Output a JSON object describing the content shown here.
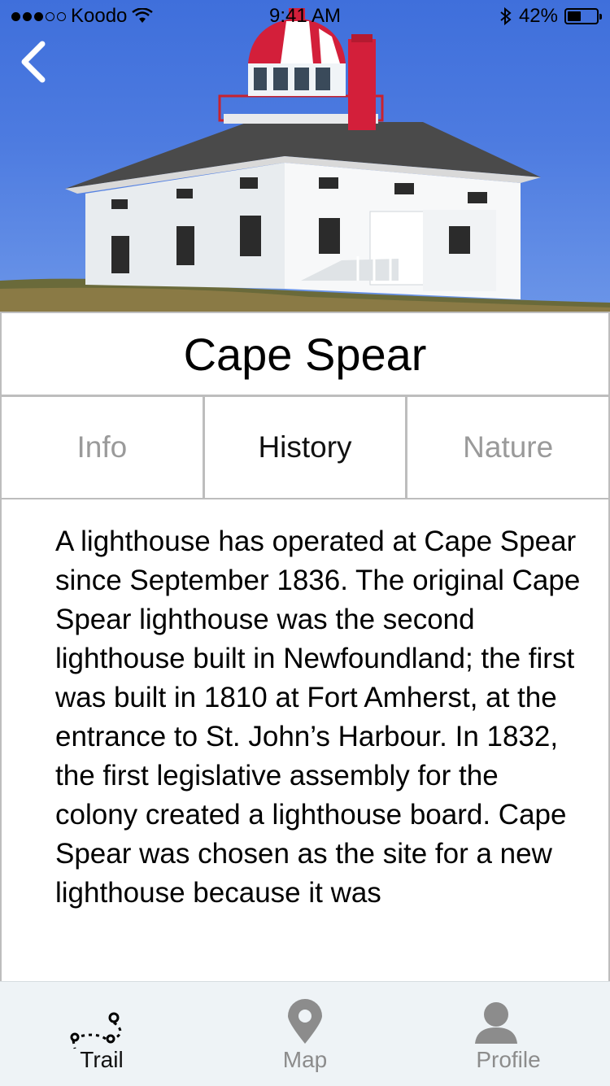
{
  "status_bar": {
    "carrier": "Koodo",
    "time": "9:41 AM",
    "battery": "42%",
    "battery_level": 0.42
  },
  "hero": {
    "subject": "Cape Spear lighthouse photo"
  },
  "header": {
    "back_icon": "chevron-left-icon",
    "title": "Cape Spear"
  },
  "tabs": [
    {
      "label": "Info",
      "active": false
    },
    {
      "label": "History",
      "active": true
    },
    {
      "label": "Nature",
      "active": false
    }
  ],
  "content": {
    "text": "A lighthouse has operated at Cape Spear since September 1836. The original Cape Spear lighthouse was the second lighthouse built in Newfoundland; the first was built in 1810 at Fort Amherst, at the entrance to St. John’s Harbour. In 1832, the first legislative assembly for the colony created a lighthouse board. Cape Spear was chosen as the site for a new lighthouse because it was"
  },
  "tab_bar": [
    {
      "label": "Trail",
      "icon": "trail-icon",
      "active": true
    },
    {
      "label": "Map",
      "icon": "map-pin-icon",
      "active": false
    },
    {
      "label": "Profile",
      "icon": "person-icon",
      "active": false
    }
  ],
  "colors": {
    "sky": "#4d7be0",
    "lighthouse_red": "#d31f3a",
    "tab_inactive": "#9a9a9a",
    "tabbar_bg": "#eef3f6",
    "border": "#bdbdbd"
  }
}
